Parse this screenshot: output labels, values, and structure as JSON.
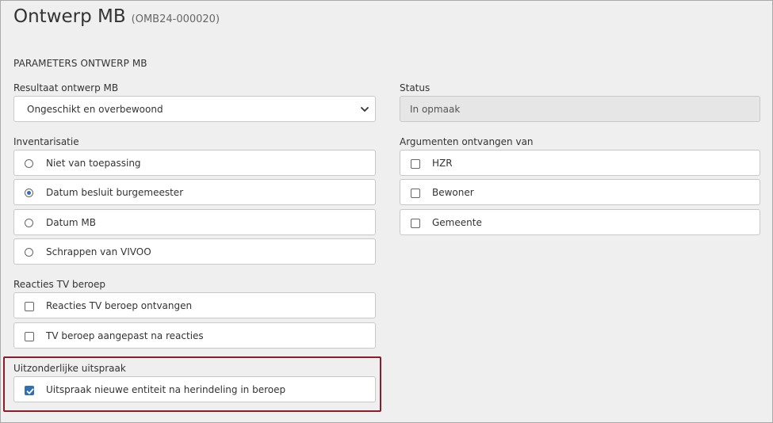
{
  "header": {
    "title": "Ontwerp MB",
    "code": "(OMB24-000020)"
  },
  "section": {
    "heading": "PARAMETERS ONTWERP MB"
  },
  "resultaat": {
    "label": "Resultaat ontwerp MB",
    "selected": "Ongeschikt en overbewoond"
  },
  "status": {
    "label": "Status",
    "value": "In opmaak"
  },
  "inventarisatie": {
    "label": "Inventarisatie",
    "options": [
      {
        "label": "Niet van toepassing",
        "checked": false
      },
      {
        "label": "Datum besluit burgemeester",
        "checked": true
      },
      {
        "label": "Datum MB",
        "checked": false
      },
      {
        "label": "Schrappen van VIVOO",
        "checked": false
      }
    ]
  },
  "argumenten": {
    "label": "Argumenten ontvangen van",
    "options": [
      {
        "label": "HZR",
        "checked": false
      },
      {
        "label": "Bewoner",
        "checked": false
      },
      {
        "label": "Gemeente",
        "checked": false
      }
    ]
  },
  "reacties": {
    "label": "Reacties TV beroep",
    "options": [
      {
        "label": "Reacties TV beroep ontvangen",
        "checked": false
      },
      {
        "label": "TV beroep aangepast na reacties",
        "checked": false
      }
    ]
  },
  "uitzonderlijk": {
    "label": "Uitzonderlijke uitspraak",
    "options": [
      {
        "label": "Uitspraak nieuwe entiteit na herindeling in beroep",
        "checked": true
      }
    ]
  },
  "colors": {
    "accent": "#2f6fb5",
    "highlight_border": "#8b1c2c"
  }
}
